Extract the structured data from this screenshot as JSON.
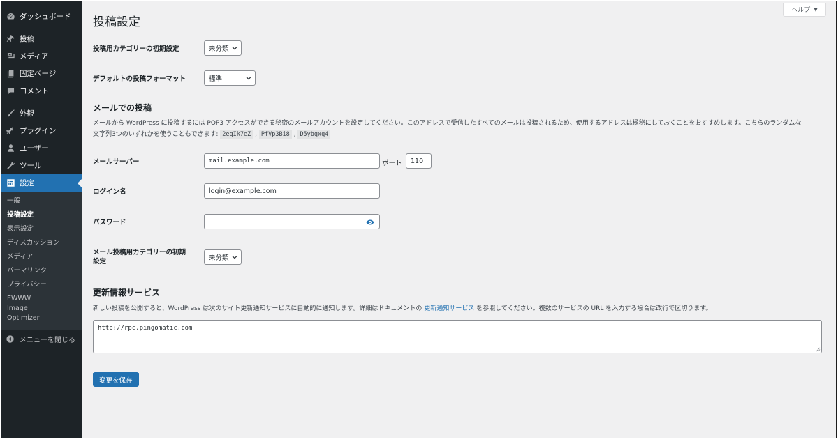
{
  "sidebar": {
    "top_items": [
      {
        "label": "ダッシュボード",
        "icon": "dashboard-icon"
      },
      {
        "label": "投稿",
        "icon": "pin-icon"
      },
      {
        "label": "メディア",
        "icon": "media-icon"
      },
      {
        "label": "固定ページ",
        "icon": "page-icon"
      },
      {
        "label": "コメント",
        "icon": "comment-icon"
      },
      {
        "label": "外観",
        "icon": "brush-icon"
      },
      {
        "label": "プラグイン",
        "icon": "plugin-icon"
      },
      {
        "label": "ユーザー",
        "icon": "user-icon"
      },
      {
        "label": "ツール",
        "icon": "wrench-icon"
      },
      {
        "label": "設定",
        "icon": "settings-icon"
      }
    ],
    "submenu": [
      "一般",
      "投稿設定",
      "表示設定",
      "ディスカッション",
      "メディア",
      "パーマリンク",
      "プライバシー",
      "EWWW Image Optimizer"
    ],
    "collapse_label": "メニューを閉じる"
  },
  "help_tab": {
    "label": "ヘルプ"
  },
  "page_title": "投稿設定",
  "default_category": {
    "label": "投稿用カテゴリーの初期設定",
    "value": "未分類"
  },
  "default_format": {
    "label": "デフォルトの投稿フォーマット",
    "value": "標準"
  },
  "post_via_email": {
    "heading": "メールでの投稿",
    "desc_line1": "メールから WordPress に投稿するには POP3 アクセスができる秘密のメールアカウントを設定してください。このアドレスで受信したすべてのメールは投稿されるため、使用するアドレスは極秘にしておくことをおすすめします。こちらのランダムな",
    "desc_line2_prefix": "文字列3つのいずれかを使うこともできます:",
    "random_strings": [
      "2eqIk7eZ",
      "PfVp3Bi8",
      "D5ybqxq4"
    ],
    "separator": ",",
    "mail_server": {
      "label": "メールサーバー",
      "value": "mail.example.com"
    },
    "port": {
      "label": "ポート",
      "value": "110"
    },
    "login": {
      "label": "ログイン名",
      "value": "login@example.com"
    },
    "password": {
      "label": "パスワード",
      "value": ""
    },
    "mail_category": {
      "label_line1": "メール投稿用カテゴリーの初期",
      "label_line2": "設定",
      "value": "未分類"
    }
  },
  "update_services": {
    "heading": "更新情報サービス",
    "desc_prefix": "新しい投稿を公開すると、WordPress は次のサイト更新通知サービスに自動的に通知します。詳細はドキュメントの",
    "desc_link": "更新通知サービス",
    "desc_suffix": "を参照してください。複数のサービスの URL を入力する場合は改行で区切ります。",
    "value": "http://rpc.pingomatic.com"
  },
  "save_button": {
    "label": "変更を保存"
  },
  "colors": {
    "sidebar_bg": "#1d2327",
    "accent": "#2271b1",
    "content_bg": "#f0f0f1"
  }
}
